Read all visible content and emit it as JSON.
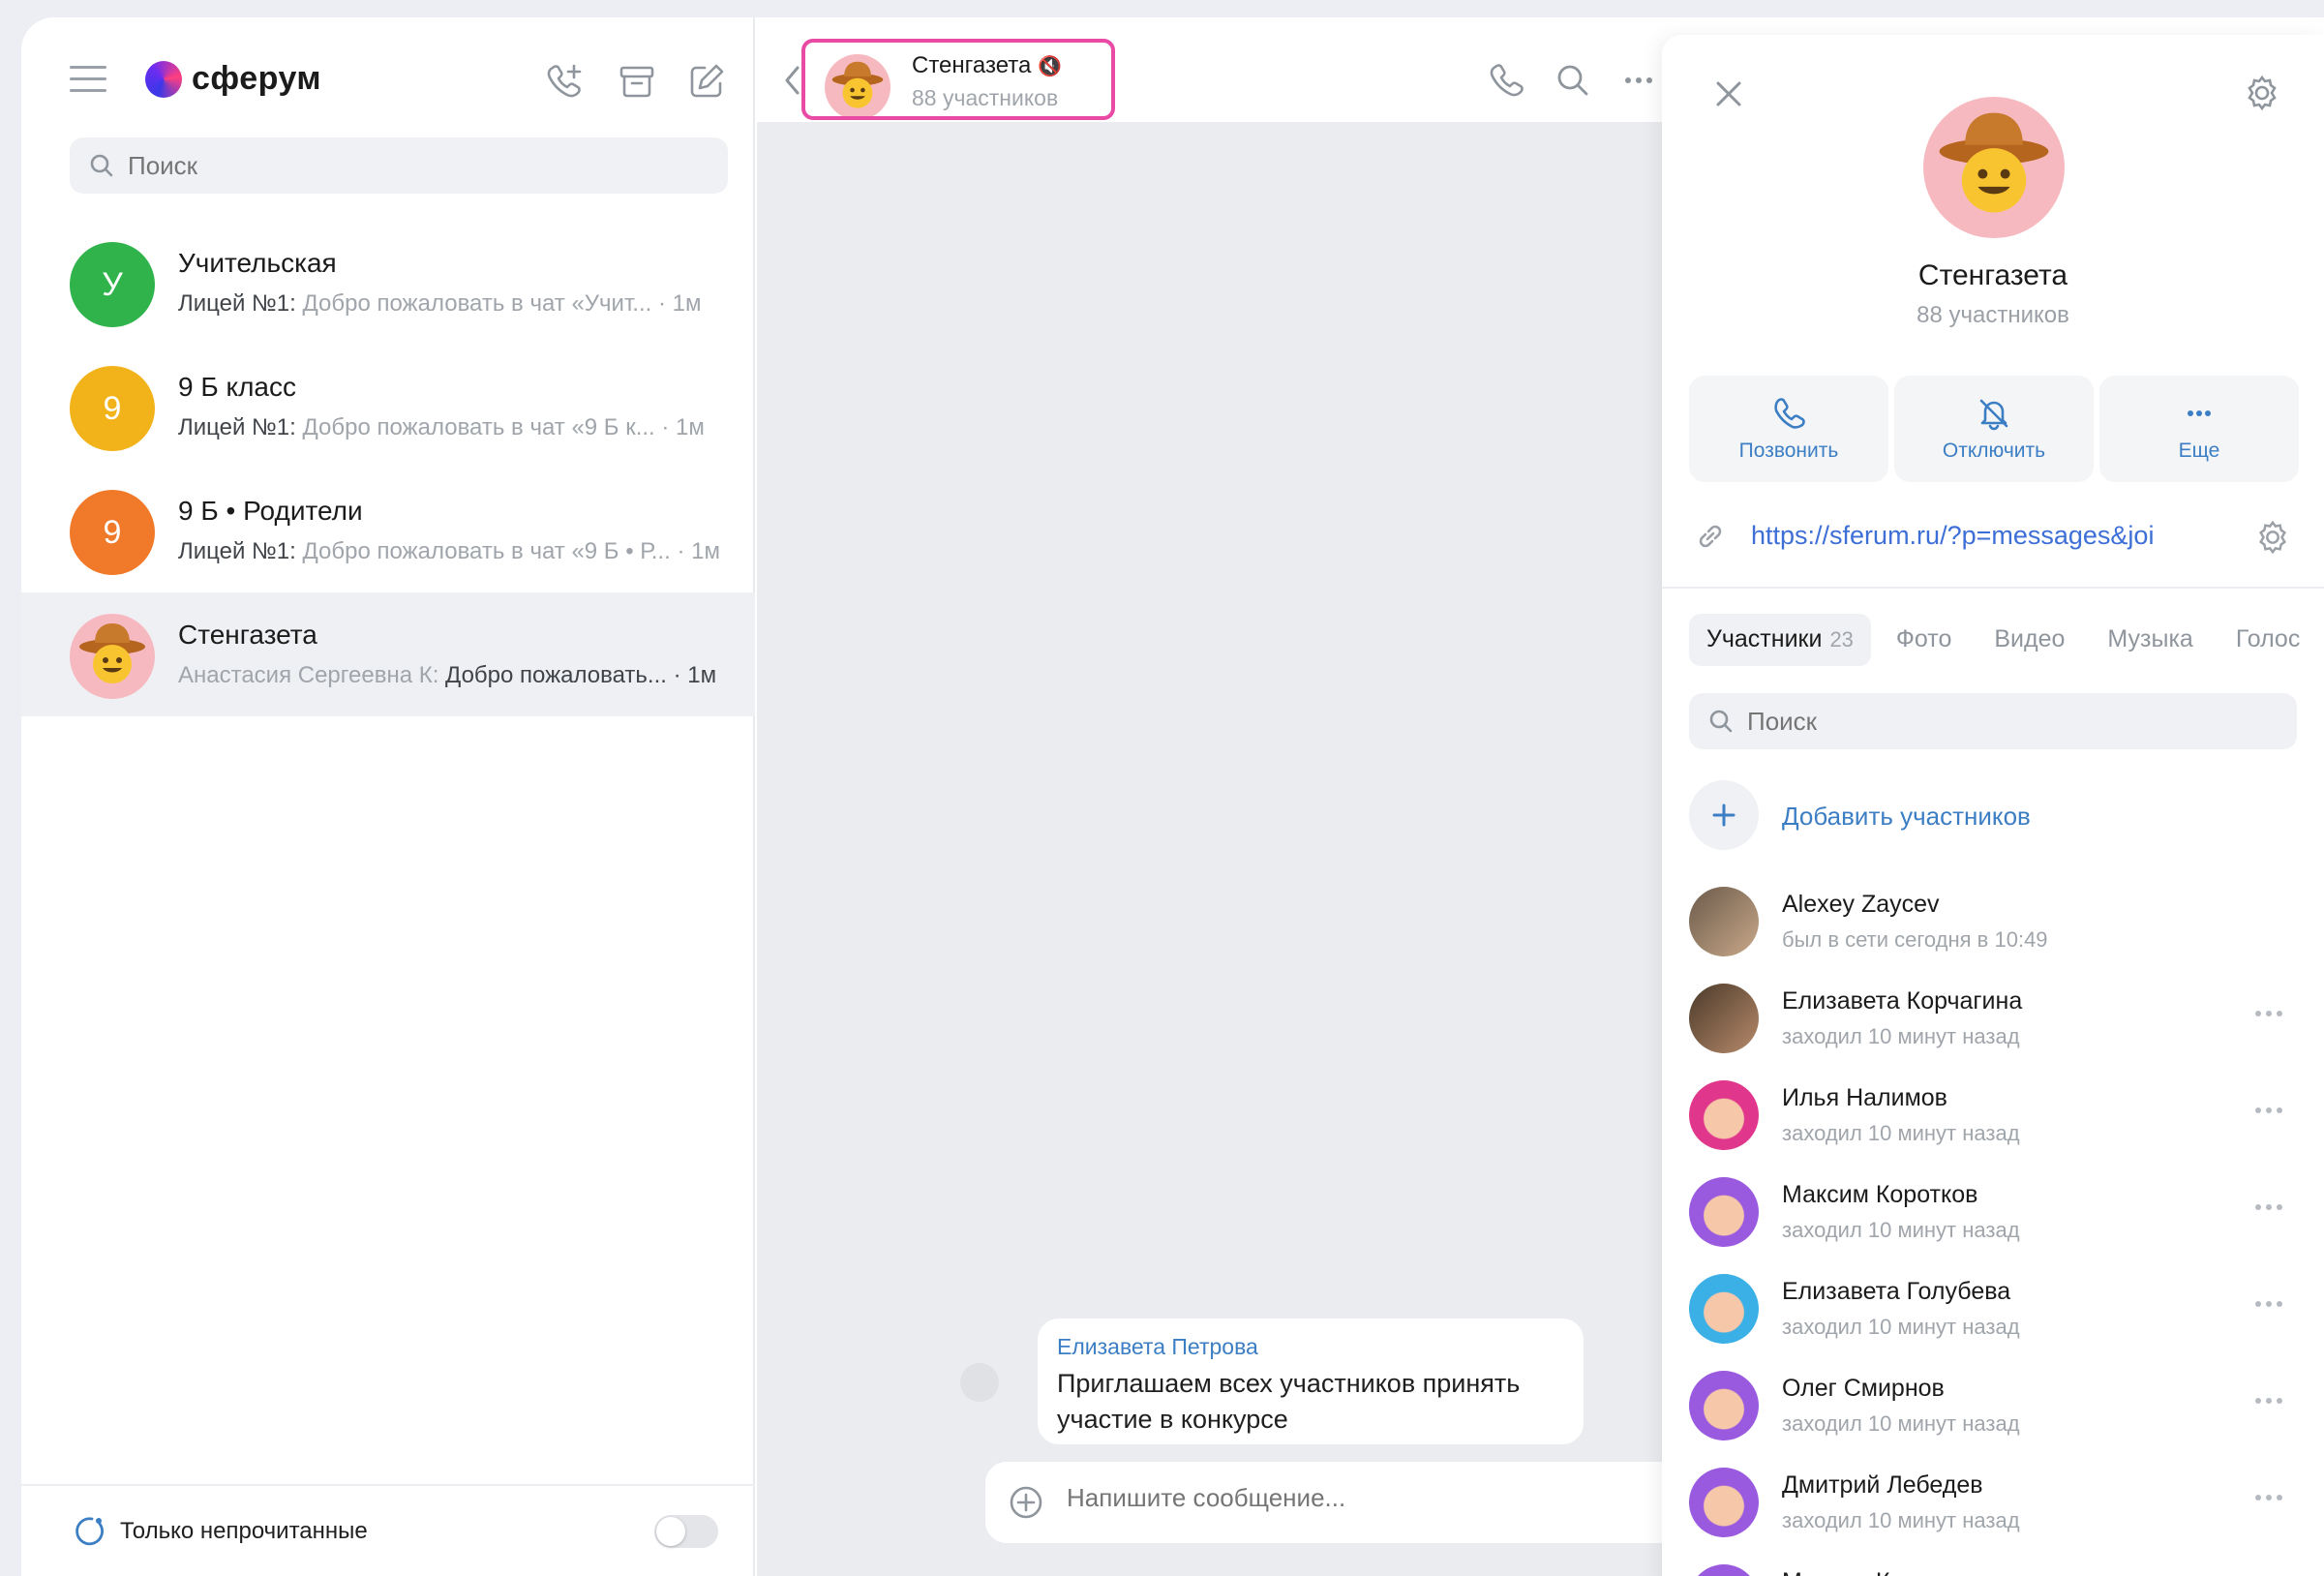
{
  "colors": {
    "accent": "#3c7ec4",
    "highlight_frame": "#e94aa4",
    "avatar_green": "#2fb34a",
    "avatar_yellow": "#f2b21a",
    "avatar_orange": "#f07a2a",
    "avatar_pink": "#f6b9bf"
  },
  "sidebar": {
    "logo": "сферум",
    "search_placeholder": "Поиск",
    "chats": [
      {
        "initial": "У",
        "title": "Учительская",
        "sender": "Лицей №1:",
        "preview": " Добро пожаловать в чат «Учит... · 1м"
      },
      {
        "initial": "9",
        "title": "9 Б класс",
        "sender": "Лицей №1:",
        "preview": " Добро пожаловать в чат «9 Б к... · 1м"
      },
      {
        "initial": "9",
        "title": "9 Б • Родители",
        "sender": "Лицей №1:",
        "preview": " Добро пожаловать в чат «9 Б • Р... · 1м"
      },
      {
        "initial": "",
        "title": "Стенгазета",
        "sender": "Анастасия Сергеевна К:",
        "preview": " Добро пожаловать... · 1м"
      }
    ],
    "footer_label": "Только непрочитанные"
  },
  "conversation": {
    "title": "Стенгазета",
    "subtitle": "88 участников",
    "message": {
      "author": "Елизавета Петрова",
      "text": "Приглашаем всех участников принять участие в конкурсе"
    },
    "composer_placeholder": "Напишите сообщение..."
  },
  "panel": {
    "title": "Стенгазета",
    "subtitle": "88 участников",
    "actions": {
      "call": "Позвонить",
      "mute": "Отключить",
      "more": "Еще"
    },
    "link": "https://sferum.ru/?p=messages&joi",
    "tabs": [
      {
        "label": "Участники",
        "count": "23"
      },
      {
        "label": "Фото"
      },
      {
        "label": "Видео"
      },
      {
        "label": "Музыка"
      },
      {
        "label": "Голос"
      }
    ],
    "search_placeholder": "Поиск",
    "add_members": "Добавить участников",
    "members": [
      {
        "name": "Alexey Zaycev",
        "status": "был в сети сегодня в 10:49"
      },
      {
        "name": "Елизавета Корчагина",
        "status": "заходил 10 минут назад"
      },
      {
        "name": "Илья Налимов",
        "status": "заходил 10 минут назад"
      },
      {
        "name": "Максим Коротков",
        "status": "заходил 10 минут назад"
      },
      {
        "name": "Елизавета Голубева",
        "status": "заходил 10 минут назад"
      },
      {
        "name": "Олег Смирнов",
        "status": "заходил 10 минут назад"
      },
      {
        "name": "Дмитрий Лебедев",
        "status": "заходил 10 минут назад"
      },
      {
        "name": "Максим Круглов",
        "status": ""
      }
    ]
  }
}
